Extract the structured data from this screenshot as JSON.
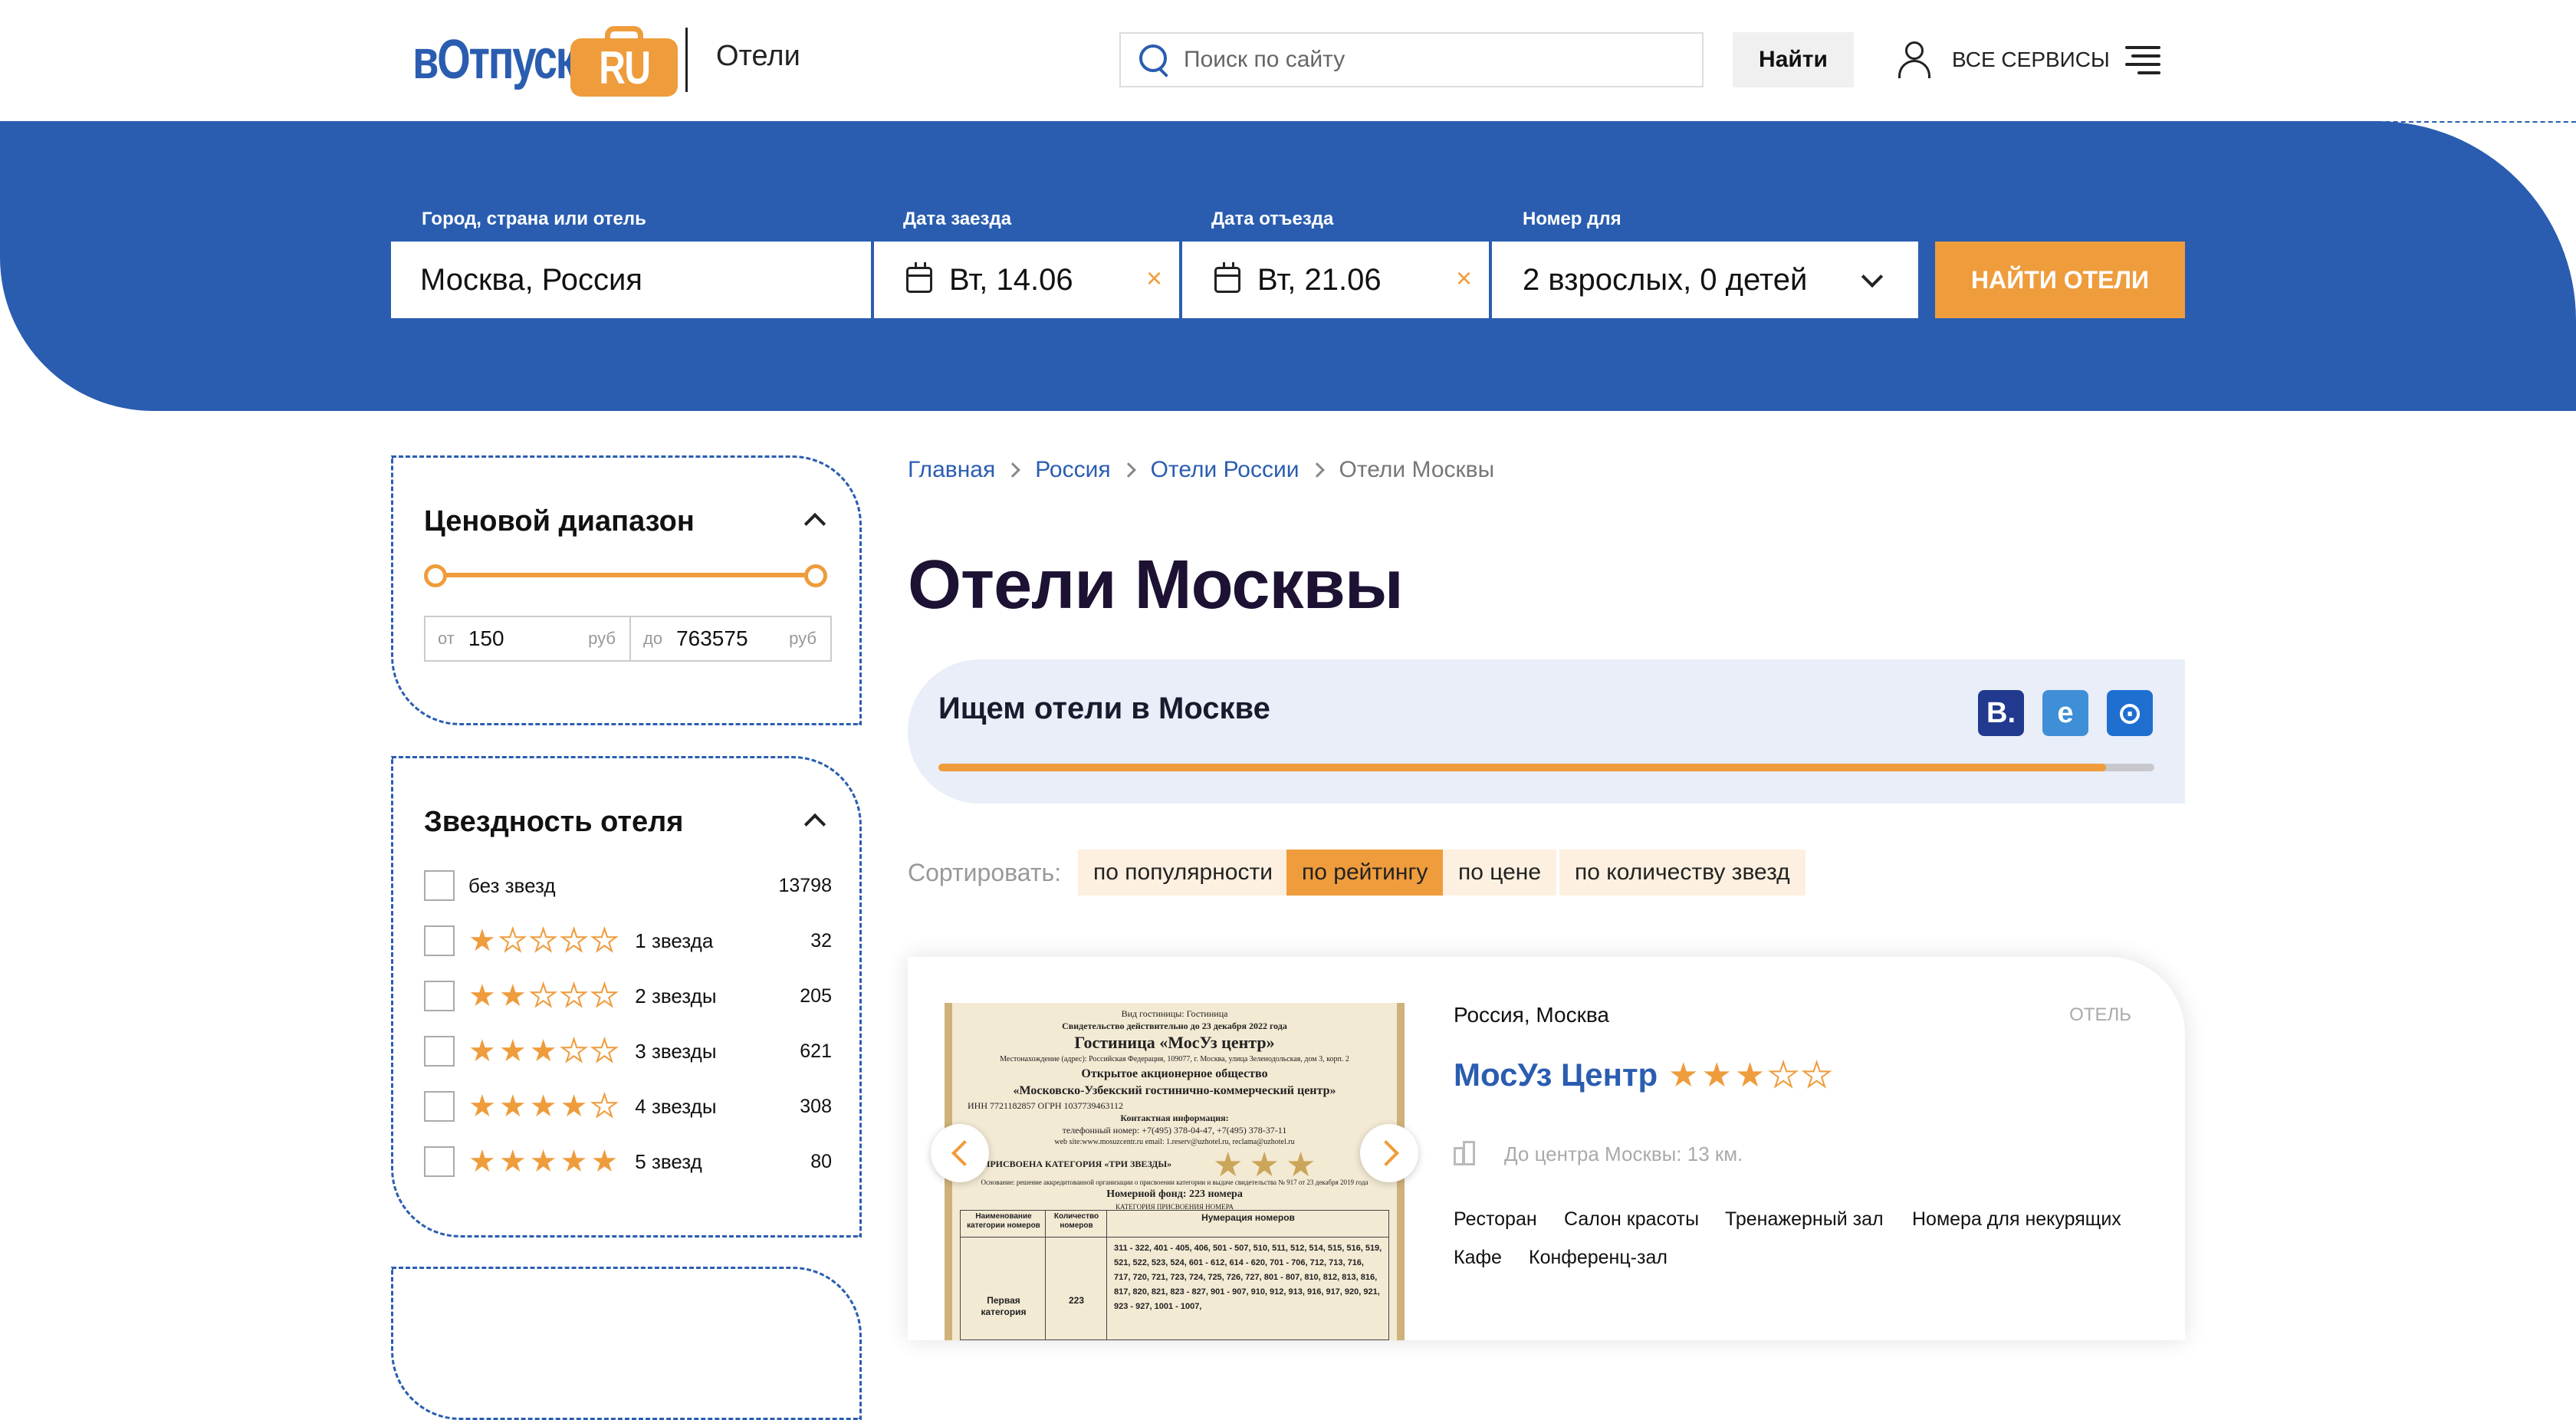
{
  "header": {
    "logo_main": "вОтпуск",
    "logo_badge": "RU",
    "section": "Отели",
    "search_placeholder": "Поиск по сайту",
    "search_button": "Найти",
    "services": "ВСЕ СЕРВИСЫ"
  },
  "search_form": {
    "city_label": "Город, страна или отель",
    "city_value": "Москва, Россия",
    "checkin_label": "Дата заезда",
    "checkin_value": "Вт, 14.06",
    "checkout_label": "Дата отъезда",
    "checkout_value": "Вт, 21.06",
    "room_label": "Номер для",
    "room_value": "2 взрослых, 0 детей",
    "clear_symbol": "×",
    "submit": "Найти отели"
  },
  "filters": {
    "price": {
      "title": "Ценовой диапазон",
      "from_prefix": "от",
      "from_value": "150",
      "to_prefix": "до",
      "to_value": "763575",
      "currency": "руб"
    },
    "stars": {
      "title": "Звездность отеля",
      "items": [
        {
          "label": "без звезд",
          "stars": 0,
          "count": "13798"
        },
        {
          "label": "1 звезда",
          "stars": 1,
          "count": "32"
        },
        {
          "label": "2 звезды",
          "stars": 2,
          "count": "205"
        },
        {
          "label": "3 звезды",
          "stars": 3,
          "count": "621"
        },
        {
          "label": "4 звезды",
          "stars": 4,
          "count": "308"
        },
        {
          "label": "5 звезд",
          "stars": 5,
          "count": "80"
        }
      ]
    }
  },
  "breadcrumbs": [
    "Главная",
    "Россия",
    "Отели России",
    "Отели Москвы"
  ],
  "page_title": "Отели Москвы",
  "searching": {
    "text": "Ищем отели в Москве",
    "providers": [
      {
        "name": "booking-icon",
        "letter": "B.",
        "color": "#213a8f"
      },
      {
        "name": "expedia-icon",
        "letter": "e",
        "color": "#3f8fd6"
      },
      {
        "name": "ostrovok-icon",
        "letter": "⊙",
        "color": "#1f6fd1"
      }
    ],
    "progress": 0.96
  },
  "sort": {
    "label": "Сортировать:",
    "options": [
      "по популярности",
      "по рейтингу",
      "по цене",
      "по количеству звезд"
    ],
    "active_index": 1
  },
  "hotel": {
    "location": "Россия, Москва",
    "type": "ОТЕЛЬ",
    "name": "МосУз Центр",
    "stars": 3,
    "distance": "До центра Москвы: 13 км.",
    "amenities": [
      "Ресторан",
      "Салон красоты",
      "Тренажерный зал",
      "Номера для некурящих",
      "Кафе",
      "Конференц-зал"
    ],
    "photo": {
      "line1": "Вид гостиницы: Гостиница",
      "line2": "Свидетельство действительно до 23 декабря 2022 года",
      "title": "Гостиница «МосУз центр»",
      "line3": "Местонахождение (адрес): Российская Федерация, 109077, г. Москва, улица Зеленодольская, дом 3, корп. 2",
      "org1": "Открытое акционерное общество",
      "org2": "«Московско-Узбекский гостинично-коммерческий центр»",
      "inn": "ИНН 7721182857   ОГРН 1037739463112",
      "contact": "Контактная информация:",
      "phone": "телефонный номер: +7(495) 378-04-47, +7(495) 378-37-11",
      "web": "web site:www.mosuzcentr.ru  email: 1.reserv@uzhotel.ru, reclama@uzhotel.ru",
      "category": "ПРИСВОЕНА КАТЕГОРИЯ   «ТРИ ЗВЕЗДЫ»",
      "basis": "Основание: решение аккредитованной организации о присвоении категории и выдаче свидетельства № 917 от 23 декабря 2019 года",
      "fund": "Номерной фонд: 223 номера",
      "fund2": "КАТЕГОРИЯ ПРИСВОЕНИЯ НОМЕРА",
      "col1": "Наименование категории номеров",
      "col2": "Количество номеров",
      "col3": "Нумерация номеров",
      "cat": "Первая категория",
      "qty": "223",
      "nums": "311 - 322, 401 - 405, 406, 501 - 507, 510, 511, 512, 514, 515, 516, 519, 521, 522, 523, 524, 601 - 612, 614 - 620, 701 - 706, 712, 713, 716, 717, 720, 721, 723, 724, 725, 726, 727, 801 - 807, 810, 812, 813, 816, 817, 820, 821, 823 - 827, 901 - 907, 910, 912, 913, 916, 917, 920, 921, 923 - 927, 1001 - 1007,"
    }
  }
}
